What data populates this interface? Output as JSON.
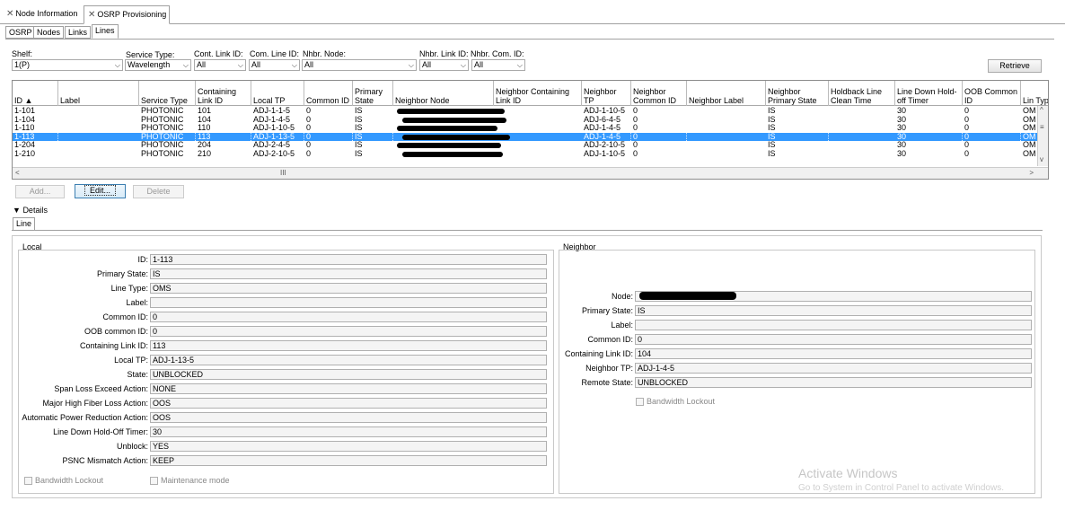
{
  "top_tabs": [
    {
      "label": "Node Information",
      "active": false
    },
    {
      "label": "OSRP Provisioning",
      "active": true
    }
  ],
  "sub_tabs": [
    {
      "label": "OSRP",
      "active": false
    },
    {
      "label": "Nodes",
      "active": false
    },
    {
      "label": "Links",
      "active": false
    },
    {
      "label": "Lines",
      "active": true
    }
  ],
  "filters": {
    "shelf": {
      "label": "Shelf:",
      "value": "1(P)"
    },
    "service_type": {
      "label": "Service Type:",
      "value": "Wavelength"
    },
    "cont_link_id": {
      "label": "Cont. Link ID:",
      "value": "All"
    },
    "com_line_id": {
      "label": "Com. Line ID:",
      "value": "All"
    },
    "nhbr_node": {
      "label": "Nhbr. Node:",
      "value": "All"
    },
    "nhbr_link_id": {
      "label": "Nhbr. Link ID:",
      "value": "All"
    },
    "nhbr_com_id": {
      "label": "Nhbr. Com. ID:",
      "value": "All"
    },
    "retrieve_label": "Retrieve"
  },
  "table": {
    "columns": [
      "ID ▲",
      "Label",
      "Service Type",
      "Containing Link ID",
      "Local TP",
      "Common ID",
      "Primary State",
      "Neighbor Node",
      "Neighbor Containing Link ID",
      "Neighbor TP",
      "Neighbor Common ID",
      "Neighbor Label",
      "Neighbor Primary State",
      "Holdback Line Clean Time",
      "Line Down Hold-off Timer",
      "OOB Common ID",
      "Lin Typ"
    ],
    "rows": [
      [
        "1-101",
        "",
        "PHOTONIC",
        "101",
        "ADJ-1-1-5",
        "0",
        "IS",
        "",
        "",
        "ADJ-1-10-5",
        "0",
        "",
        "IS",
        "",
        "30",
        "0",
        "OM"
      ],
      [
        "1-104",
        "",
        "PHOTONIC",
        "104",
        "ADJ-1-4-5",
        "0",
        "IS",
        "",
        "",
        "ADJ-6-4-5",
        "0",
        "",
        "IS",
        "",
        "30",
        "0",
        "OM"
      ],
      [
        "1-110",
        "",
        "PHOTONIC",
        "110",
        "ADJ-1-10-5",
        "0",
        "IS",
        "",
        "",
        "ADJ-1-4-5",
        "0",
        "",
        "IS",
        "",
        "30",
        "0",
        "OM"
      ],
      [
        "1-113",
        "",
        "PHOTONIC",
        "113",
        "ADJ-1-13-5",
        "0",
        "IS",
        "",
        "",
        "ADJ-1-4-5",
        "0",
        "",
        "IS",
        "",
        "30",
        "0",
        "OM"
      ],
      [
        "1-204",
        "",
        "PHOTONIC",
        "204",
        "ADJ-2-4-5",
        "0",
        "IS",
        "",
        "",
        "ADJ-2-10-5",
        "0",
        "",
        "IS",
        "",
        "30",
        "0",
        "OM"
      ],
      [
        "1-210",
        "",
        "PHOTONIC",
        "210",
        "ADJ-2-10-5",
        "0",
        "IS",
        "",
        "",
        "ADJ-1-10-5",
        "0",
        "",
        "IS",
        "",
        "30",
        "0",
        "OM"
      ]
    ],
    "selected_row": 3
  },
  "actions": {
    "add": "Add...",
    "edit": "Edit...",
    "delete": "Delete"
  },
  "details": {
    "header": "Details",
    "tab": "Line",
    "local": {
      "title": "Local",
      "fields": [
        {
          "label": "ID:",
          "value": "1-113"
        },
        {
          "label": "Primary State:",
          "value": "IS"
        },
        {
          "label": "Line Type:",
          "value": "OMS"
        },
        {
          "label": "Label:",
          "value": ""
        },
        {
          "label": "Common ID:",
          "value": "0"
        },
        {
          "label": "OOB common ID:",
          "value": "0"
        },
        {
          "label": "Containing Link ID:",
          "value": "113"
        },
        {
          "label": "Local TP:",
          "value": "ADJ-1-13-5"
        },
        {
          "label": "State:",
          "value": "UNBLOCKED"
        },
        {
          "label": "Span Loss Exceed Action:",
          "value": "NONE"
        },
        {
          "label": "Major High Fiber Loss Action:",
          "value": "OOS"
        },
        {
          "label": "Automatic Power Reduction Action:",
          "value": "OOS"
        },
        {
          "label": "Line Down Hold-Off Timer:",
          "value": "30"
        },
        {
          "label": "Unblock:",
          "value": "YES"
        },
        {
          "label": "PSNC Mismatch Action:",
          "value": "KEEP"
        }
      ],
      "bandwidth_lockout": "Bandwidth Lockout",
      "maintenance_mode": "Maintenance mode"
    },
    "neighbor": {
      "title": "Neighbor",
      "fields": [
        {
          "label": "Node:",
          "value": ""
        },
        {
          "label": "Primary State:",
          "value": "IS"
        },
        {
          "label": "Label:",
          "value": ""
        },
        {
          "label": "Common ID:",
          "value": "0"
        },
        {
          "label": "Containing Link ID:",
          "value": "104"
        },
        {
          "label": "Neighbor TP:",
          "value": "ADJ-1-4-5"
        },
        {
          "label": "Remote State:",
          "value": "UNBLOCKED"
        }
      ],
      "bandwidth_lockout": "Bandwidth Lockout"
    }
  },
  "watermark": {
    "line1": "Activate Windows",
    "line2": "Go to System in Control Panel to activate Windows."
  }
}
